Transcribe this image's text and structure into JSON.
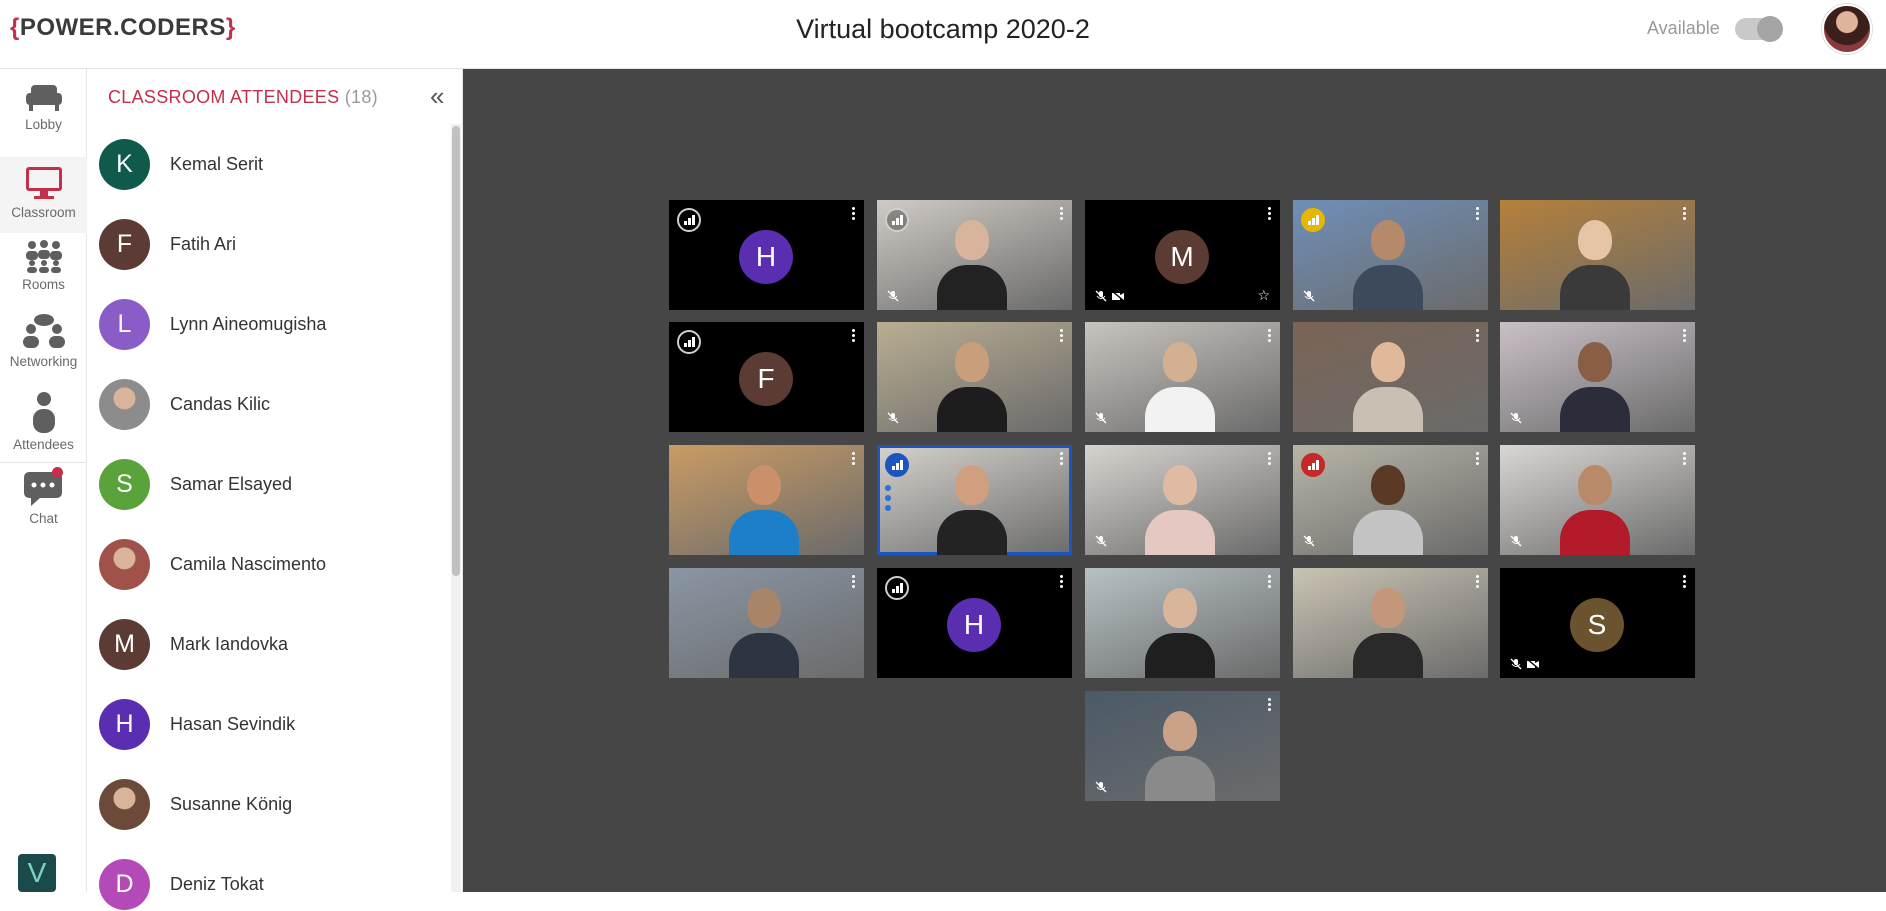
{
  "header": {
    "logo_left": "{",
    "logo_text": "POWER.CODERS",
    "logo_right": "}",
    "title": "Virtual bootcamp 2020-2",
    "availability_label": "Available",
    "availability_on": true
  },
  "nav": {
    "items": [
      {
        "label": "Lobby",
        "icon": "sofa-icon"
      },
      {
        "label": "Classroom",
        "icon": "monitor-icon",
        "active": true
      },
      {
        "label": "Rooms",
        "icon": "group-icon"
      },
      {
        "label": "Networking",
        "icon": "people-chat-icon"
      },
      {
        "label": "Attendees",
        "icon": "person-icon"
      },
      {
        "label": "Chat",
        "icon": "chat-icon",
        "has_notification": true
      }
    ],
    "bottom_logo": "V"
  },
  "panel": {
    "title": "CLASSROOM ATTENDEES",
    "count": "(18)",
    "collapse_glyph": "«",
    "attendees": [
      {
        "initial": "K",
        "name": "Kemal Serit",
        "color": "#0f5a4a"
      },
      {
        "initial": "F",
        "name": "Fatih Ari",
        "color": "#5b3b33"
      },
      {
        "initial": "L",
        "name": "Lynn Aineomugisha",
        "color": "#8a5cc7"
      },
      {
        "initial": "",
        "name": "Candas Kilic",
        "color": "#8c8c8c",
        "photo": true
      },
      {
        "initial": "S",
        "name": "Samar Elsayed",
        "color": "#5aa33a"
      },
      {
        "initial": "",
        "name": "Camila Nascimento",
        "color": "#a0524a",
        "photo": true
      },
      {
        "initial": "M",
        "name": "Mark Iandovka",
        "color": "#5b3b33"
      },
      {
        "initial": "H",
        "name": "Hasan Sevindik",
        "color": "#5a2eb0"
      },
      {
        "initial": "",
        "name": "Susanne König",
        "color": "#6b4a3a",
        "photo": true
      },
      {
        "initial": "D",
        "name": "Deniz Tokat",
        "color": "#b44ab8"
      }
    ]
  },
  "tiles": [
    {
      "type": "avatar",
      "initial": "H",
      "color": "#5a2eb0",
      "signal": "grey"
    },
    {
      "type": "video",
      "bg": "#cfcac4",
      "skin": "#d8b49c",
      "shirt": "#222",
      "signal": "grey",
      "mic_muted": true
    },
    {
      "type": "avatar",
      "initial": "M",
      "color": "#5b3b33",
      "mic_muted": true,
      "cam_off": true,
      "starred": true
    },
    {
      "type": "video",
      "bg": "#6f8fb8",
      "skin": "#b58a6a",
      "shirt": "#3d4a5c",
      "signal": "yellow",
      "mic_muted": true
    },
    {
      "type": "video",
      "bg": "#b5803a",
      "skin": "#e6c4a6",
      "shirt": "#3a3a3a"
    },
    {
      "type": "avatar",
      "initial": "F",
      "color": "#5b3b33",
      "signal": "grey"
    },
    {
      "type": "video",
      "bg": "#b9ae92",
      "skin": "#c99e7a",
      "shirt": "#1d1d1d",
      "mic_muted": true
    },
    {
      "type": "video",
      "bg": "#c8c4bf",
      "skin": "#d4b092",
      "shirt": "#f2f2f2",
      "mic_muted": true
    },
    {
      "type": "video",
      "bg": "#7a6455",
      "skin": "#e0b99a",
      "shirt": "#c9c0b3"
    },
    {
      "type": "video",
      "bg": "#c9c0c7",
      "skin": "#8a5e44",
      "shirt": "#2c2d3a",
      "mic_muted": true
    },
    {
      "type": "video",
      "bg": "#c99b64",
      "skin": "#c9906a",
      "shirt": "#1e7fc9"
    },
    {
      "type": "video",
      "bg": "#d6d2cd",
      "skin": "#cf9f80",
      "shirt": "#232323",
      "signal": "blue",
      "speaking": true
    },
    {
      "type": "video",
      "bg": "#d7d3cf",
      "skin": "#e0bba3",
      "shirt": "#e6c8c2",
      "mic_muted": true
    },
    {
      "type": "video",
      "bg": "#b8b5a6",
      "skin": "#5a3a26",
      "shirt": "#c4c4c4",
      "signal": "red",
      "mic_muted": true
    },
    {
      "type": "video",
      "bg": "#d9d7d3",
      "skin": "#b88a6a",
      "shirt": "#b31a2a",
      "mic_muted": true
    },
    {
      "type": "video",
      "bg": "#8a96a4",
      "skin": "#a88468",
      "shirt": "#2d3442"
    },
    {
      "type": "avatar",
      "initial": "H",
      "color": "#5a2eb0",
      "signal": "grey"
    },
    {
      "type": "video",
      "bg": "#b6c1c4",
      "skin": "#d9b59c",
      "shirt": "#1f1f1f"
    },
    {
      "type": "video",
      "bg": "#c9c3b2",
      "skin": "#c4977a",
      "shirt": "#2a2a2a"
    },
    {
      "type": "avatar",
      "initial": "S",
      "color": "#6b5330",
      "mic_muted": true,
      "cam_off": true
    },
    {
      "type": "video",
      "bg": "#4b5a68",
      "skin": "#caa288",
      "shirt": "#8a8a8a",
      "mic_muted": true
    }
  ]
}
